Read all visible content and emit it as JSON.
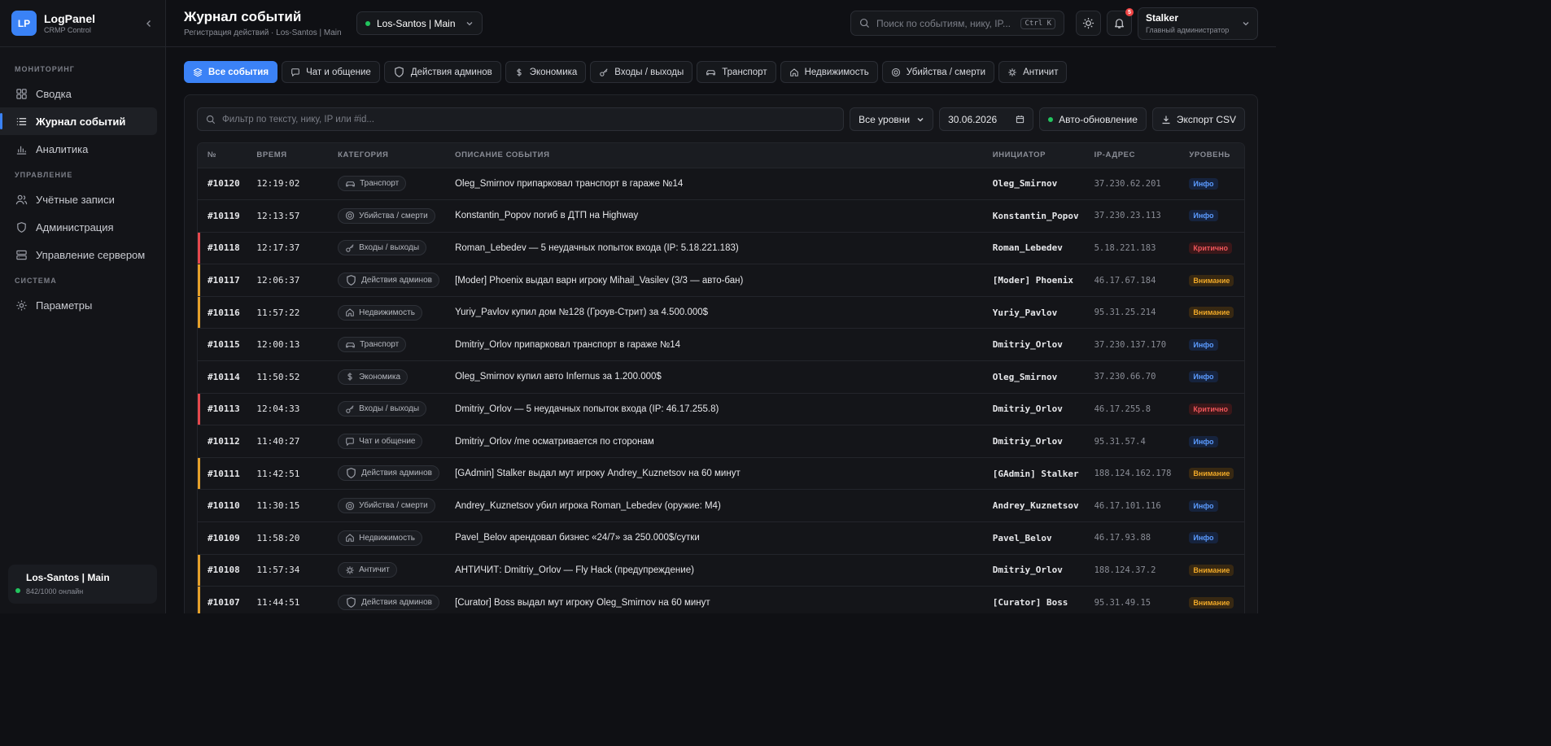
{
  "brand": {
    "logo": "LP",
    "name": "LogPanel",
    "sub": "CRMP Control"
  },
  "sidebar": {
    "sections": [
      {
        "title": "МОНИТОРИНГ",
        "items": [
          {
            "label": "Сводка",
            "icon": "grid-icon",
            "active": false
          },
          {
            "label": "Журнал событий",
            "icon": "list-icon",
            "active": true
          },
          {
            "label": "Аналитика",
            "icon": "chart-icon",
            "active": false
          }
        ]
      },
      {
        "title": "УПРАВЛЕНИЕ",
        "items": [
          {
            "label": "Учётные записи",
            "icon": "users-icon",
            "active": false
          },
          {
            "label": "Администрация",
            "icon": "shield-icon",
            "active": false
          },
          {
            "label": "Управление сервером",
            "icon": "server-icon",
            "active": false
          }
        ]
      },
      {
        "title": "СИСТЕМА",
        "items": [
          {
            "label": "Параметры",
            "icon": "gear-icon",
            "active": false
          }
        ]
      }
    ],
    "server": {
      "name": "Los-Santos | Main",
      "online": "842/1000 онлайн",
      "status_color": "#22c55e"
    }
  },
  "header": {
    "title": "Журнал событий",
    "subtitle": "Регистрация действий · Los-Santos | Main",
    "server_select": "Los-Santos | Main",
    "search_placeholder": "Поиск по событиям, нику, IP...",
    "search_shortcut": "Ctrl K",
    "notifications_count": "5",
    "user": {
      "name": "Stalker",
      "role": "Главный администратор"
    }
  },
  "tabs": [
    {
      "label": "Все события",
      "icon": "layers-icon",
      "active": true
    },
    {
      "label": "Чат и общение",
      "icon": "chat-icon",
      "active": false
    },
    {
      "label": "Действия админов",
      "icon": "shield-icon",
      "active": false
    },
    {
      "label": "Экономика",
      "icon": "dollar-icon",
      "active": false
    },
    {
      "label": "Входы / выходы",
      "icon": "key-icon",
      "active": false
    },
    {
      "label": "Транспорт",
      "icon": "car-icon",
      "active": false
    },
    {
      "label": "Недвижимость",
      "icon": "home-icon",
      "active": false
    },
    {
      "label": "Убийства / смерти",
      "icon": "target-icon",
      "active": false
    },
    {
      "label": "Античит",
      "icon": "bug-icon",
      "active": false
    }
  ],
  "filters": {
    "text_placeholder": "Фильтр по тексту, нику, IP или #id...",
    "level_select": "Все уровни",
    "date": "30.06.2026",
    "auto_refresh": "Авто-обновление",
    "export": "Экспорт CSV"
  },
  "table": {
    "columns": [
      "№",
      "ВРЕМЯ",
      "КАТЕГОРИЯ",
      "ОПИСАНИЕ СОБЫТИЯ",
      "ИНИЦИАТОР",
      "IP-АДРЕС",
      "УРОВЕНЬ"
    ],
    "rows": [
      {
        "id": "#10120",
        "time": "12:19:02",
        "category": "Транспорт",
        "cat_icon": "car-icon",
        "desc": "Oleg_Smirnov припарковал транспорт в гараже №14",
        "initiator": "Oleg_Smirnov",
        "ip": "37.230.62.201",
        "level": "Инфо",
        "level_kind": "info"
      },
      {
        "id": "#10119",
        "time": "12:13:57",
        "category": "Убийства / смерти",
        "cat_icon": "target-icon",
        "desc": "Konstantin_Popov погиб в ДТП на Highway",
        "initiator": "Konstantin_Popov",
        "ip": "37.230.23.113",
        "level": "Инфо",
        "level_kind": "info"
      },
      {
        "id": "#10118",
        "time": "12:17:37",
        "category": "Входы / выходы",
        "cat_icon": "key-icon",
        "desc": "Roman_Lebedev — 5 неудачных попыток входа (IP: 5.18.221.183)",
        "initiator": "Roman_Lebedev",
        "ip": "5.18.221.183",
        "level": "Критично",
        "level_kind": "crit"
      },
      {
        "id": "#10117",
        "time": "12:06:37",
        "category": "Действия админов",
        "cat_icon": "shield-icon",
        "desc": "[Moder] Phoenix выдал варн игроку Mihail_Vasilev (3/3 — авто-бан)",
        "initiator": "[Moder] Phoenix",
        "ip": "46.17.67.184",
        "level": "Внимание",
        "level_kind": "warn"
      },
      {
        "id": "#10116",
        "time": "11:57:22",
        "category": "Недвижимость",
        "cat_icon": "home-icon",
        "desc": "Yuriy_Pavlov купил дом №128 (Гроув-Стрит) за 4.500.000$",
        "initiator": "Yuriy_Pavlov",
        "ip": "95.31.25.214",
        "level": "Внимание",
        "level_kind": "warn"
      },
      {
        "id": "#10115",
        "time": "12:00:13",
        "category": "Транспорт",
        "cat_icon": "car-icon",
        "desc": "Dmitriy_Orlov припарковал транспорт в гараже №14",
        "initiator": "Dmitriy_Orlov",
        "ip": "37.230.137.170",
        "level": "Инфо",
        "level_kind": "info"
      },
      {
        "id": "#10114",
        "time": "11:50:52",
        "category": "Экономика",
        "cat_icon": "dollar-icon",
        "desc": "Oleg_Smirnov купил авто Infernus за 1.200.000$",
        "initiator": "Oleg_Smirnov",
        "ip": "37.230.66.70",
        "level": "Инфо",
        "level_kind": "info"
      },
      {
        "id": "#10113",
        "time": "12:04:33",
        "category": "Входы / выходы",
        "cat_icon": "key-icon",
        "desc": "Dmitriy_Orlov — 5 неудачных попыток входа (IP: 46.17.255.8)",
        "initiator": "Dmitriy_Orlov",
        "ip": "46.17.255.8",
        "level": "Критично",
        "level_kind": "crit"
      },
      {
        "id": "#10112",
        "time": "11:40:27",
        "category": "Чат и общение",
        "cat_icon": "chat-icon",
        "desc": "Dmitriy_Orlov /me осматривается по сторонам",
        "initiator": "Dmitriy_Orlov",
        "ip": "95.31.57.4",
        "level": "Инфо",
        "level_kind": "info"
      },
      {
        "id": "#10111",
        "time": "11:42:51",
        "category": "Действия админов",
        "cat_icon": "shield-icon",
        "desc": "[GAdmin] Stalker выдал мут игроку Andrey_Kuznetsov на 60 минут",
        "initiator": "[GAdmin] Stalker",
        "ip": "188.124.162.178",
        "level": "Внимание",
        "level_kind": "warn"
      },
      {
        "id": "#10110",
        "time": "11:30:15",
        "category": "Убийства / смерти",
        "cat_icon": "target-icon",
        "desc": "Andrey_Kuznetsov убил игрока Roman_Lebedev (оружие: M4)",
        "initiator": "Andrey_Kuznetsov",
        "ip": "46.17.101.116",
        "level": "Инфо",
        "level_kind": "info"
      },
      {
        "id": "#10109",
        "time": "11:58:20",
        "category": "Недвижимость",
        "cat_icon": "home-icon",
        "desc": "Pavel_Belov арендовал бизнес «24/7» за 250.000$/сутки",
        "initiator": "Pavel_Belov",
        "ip": "46.17.93.88",
        "level": "Инфо",
        "level_kind": "info"
      },
      {
        "id": "#10108",
        "time": "11:57:34",
        "category": "Античит",
        "cat_icon": "bug-icon",
        "desc": "АНТИЧИТ: Dmitriy_Orlov — Fly Hack (предупреждение)",
        "initiator": "Dmitriy_Orlov",
        "ip": "188.124.37.2",
        "level": "Внимание",
        "level_kind": "warn"
      },
      {
        "id": "#10107",
        "time": "11:44:51",
        "category": "Действия админов",
        "cat_icon": "shield-icon",
        "desc": "[Curator] Boss выдал мут игроку Oleg_Smirnov на 60 минут",
        "initiator": "[Curator] Boss",
        "ip": "95.31.49.15",
        "level": "Внимание",
        "level_kind": "warn"
      }
    ]
  },
  "colors": {
    "accent": "#3b82f6",
    "online": "#22c55e",
    "critical": "#e5484d",
    "warning": "#e5a02a"
  }
}
